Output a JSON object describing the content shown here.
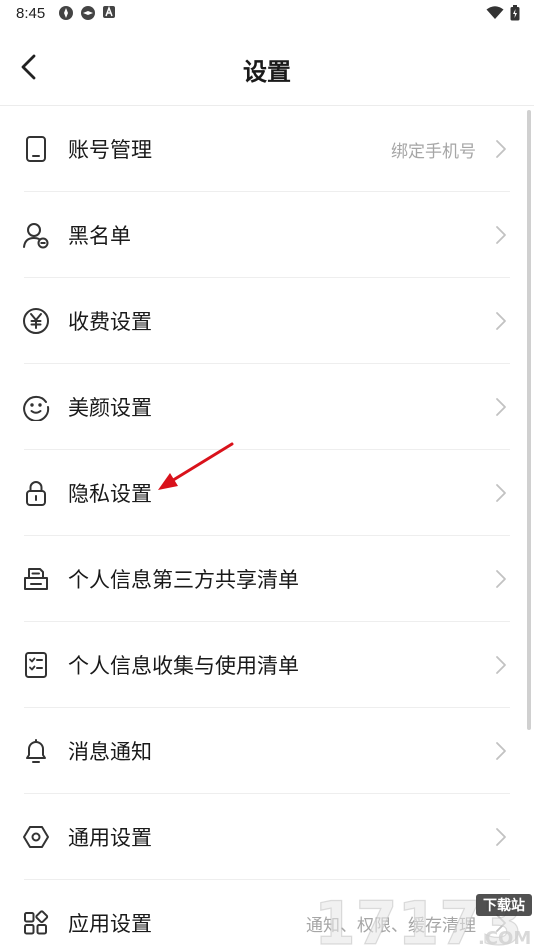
{
  "status_bar": {
    "time": "8:45"
  },
  "header": {
    "title": "设置"
  },
  "menu": [
    {
      "label": "账号管理",
      "value": "绑定手机号",
      "icon": "phone-icon"
    },
    {
      "label": "黑名单",
      "value": "",
      "icon": "user-block-icon"
    },
    {
      "label": "收费设置",
      "value": "",
      "icon": "yen-icon"
    },
    {
      "label": "美颜设置",
      "value": "",
      "icon": "face-icon"
    },
    {
      "label": "隐私设置",
      "value": "",
      "icon": "lock-icon"
    },
    {
      "label": "个人信息第三方共享清单",
      "value": "",
      "icon": "share-list-icon"
    },
    {
      "label": "个人信息收集与使用清单",
      "value": "",
      "icon": "checklist-icon"
    },
    {
      "label": "消息通知",
      "value": "",
      "icon": "bell-icon"
    },
    {
      "label": "通用设置",
      "value": "",
      "icon": "hexagon-settings-icon"
    },
    {
      "label": "应用设置",
      "value": "通知、权限、缓存清理",
      "icon": "apps-grid-icon"
    }
  ],
  "watermark": {
    "number": "17173",
    "tag": "下载站",
    "domain": ".COM"
  },
  "colors": {
    "background": "#ffffff",
    "text": "#1a1a1a",
    "secondary_text": "#a6a6a6",
    "separator": "#eeeeee",
    "annotation_arrow": "#d9121b"
  }
}
